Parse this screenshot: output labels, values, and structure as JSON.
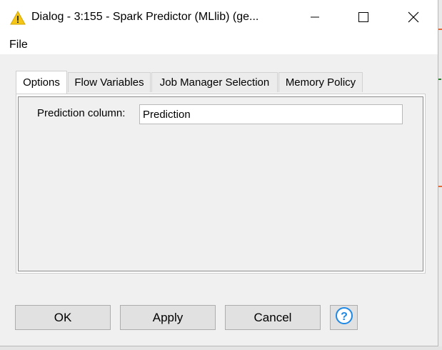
{
  "window": {
    "title": "Dialog - 3:155 - Spark Predictor (MLlib) (ge...",
    "controls": {
      "minimize_icon": "minimize-icon",
      "maximize_icon": "maximize-icon",
      "close_icon": "close-icon"
    }
  },
  "menubar": {
    "file_label": "File"
  },
  "tabs": [
    {
      "label": "Options",
      "active": true
    },
    {
      "label": "Flow Variables",
      "active": false
    },
    {
      "label": "Job Manager Selection",
      "active": false
    },
    {
      "label": "Memory Policy",
      "active": false
    }
  ],
  "options": {
    "prediction_column_label": "Prediction column:",
    "prediction_column_value": "Prediction"
  },
  "buttons": {
    "ok_label": "OK",
    "apply_label": "Apply",
    "cancel_label": "Cancel",
    "help_icon": "help-icon"
  },
  "colors": {
    "accent_warning": "#f5c518",
    "help_blue": "#1e88e5"
  }
}
